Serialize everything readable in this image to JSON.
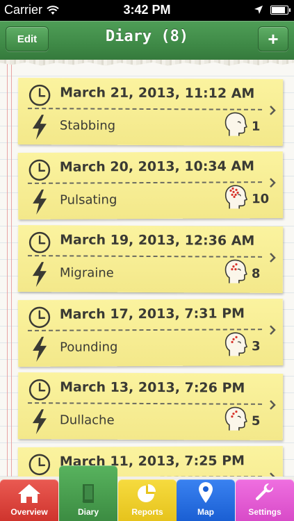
{
  "status_bar": {
    "carrier": "Carrier",
    "time": "3:42 PM"
  },
  "nav": {
    "edit_label": "Edit",
    "title": "Diary (8)",
    "add_label": "+"
  },
  "entries": [
    {
      "date": "March 21, 2013, 11:12 AM",
      "type": "Stabbing",
      "intensity": "1",
      "spots": 0
    },
    {
      "date": "March 20, 2013, 10:34 AM",
      "type": "Pulsating",
      "intensity": "10",
      "spots": 8
    },
    {
      "date": "March 19, 2013, 12:36 AM",
      "type": "Migraine",
      "intensity": "8",
      "spots": 4
    },
    {
      "date": "March 17, 2013, 7:31 PM",
      "type": "Pounding",
      "intensity": "3",
      "spots": 3
    },
    {
      "date": "March 13, 2013, 7:26 PM",
      "type": "Dullache",
      "intensity": "5",
      "spots": 3
    },
    {
      "date": "March 11, 2013, 7:25 PM",
      "type": "",
      "intensity": "",
      "spots": 0
    }
  ],
  "tabs": [
    {
      "label": "Overview",
      "icon": "home-icon"
    },
    {
      "label": "Diary",
      "icon": "book-icon"
    },
    {
      "label": "Reports",
      "icon": "pie-chart-icon"
    },
    {
      "label": "Map",
      "icon": "map-pin-icon"
    },
    {
      "label": "Settings",
      "icon": "wrench-icon"
    }
  ],
  "colors": {
    "nav_green": "#3f8a47",
    "note_yellow": "#f8ef97",
    "tab_overview": "#d9413a",
    "tab_diary": "#47a04e",
    "tab_reports": "#f0d02c",
    "tab_map": "#256fe0",
    "tab_settings": "#e05bd2"
  }
}
